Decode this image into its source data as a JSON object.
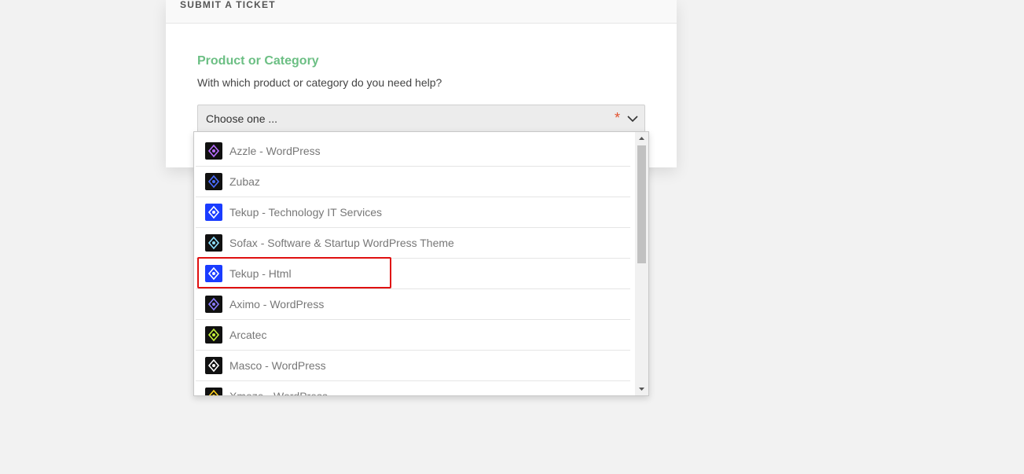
{
  "header": {
    "title": "SUBMIT A TICKET"
  },
  "field": {
    "title": "Product or Category",
    "description": "With which product or category do you need help?",
    "select_value": "Choose one ...",
    "required_mark": "*"
  },
  "options": [
    {
      "label": "Azzle - WordPress",
      "icon": "azzle-logo-icon",
      "bg": "#111111",
      "fg": "#b76cff"
    },
    {
      "label": "Zubaz",
      "icon": "zubaz-logo-icon",
      "bg": "#111111",
      "fg": "#4a6cff"
    },
    {
      "label": "Tekup - Technology IT Services",
      "icon": "tekup-logo-icon",
      "bg": "#1a3cff",
      "fg": "#ffffff"
    },
    {
      "label": "Sofax - Software & Startup WordPress Theme",
      "icon": "sofax-logo-icon",
      "bg": "#111111",
      "fg": "#8ee0ff"
    },
    {
      "label": "Tekup - Html",
      "icon": "tekup-html-logo-icon",
      "bg": "#1a3cff",
      "fg": "#ffffff"
    },
    {
      "label": "Aximo - WordPress",
      "icon": "aximo-logo-icon",
      "bg": "#111111",
      "fg": "#8a7bff"
    },
    {
      "label": "Arcatec",
      "icon": "arcatec-logo-icon",
      "bg": "#111111",
      "fg": "#c6f23a"
    },
    {
      "label": "Masco - WordPress",
      "icon": "masco-logo-icon",
      "bg": "#111111",
      "fg": "#ffffff"
    },
    {
      "label": "Xmoze - WordPress",
      "icon": "xmoze-logo-icon",
      "bg": "#111111",
      "fg": "#ffd21a"
    }
  ],
  "colors": {
    "accent_green": "#6cbf84",
    "required_red": "#e2522f",
    "highlight_red": "#e01010"
  }
}
